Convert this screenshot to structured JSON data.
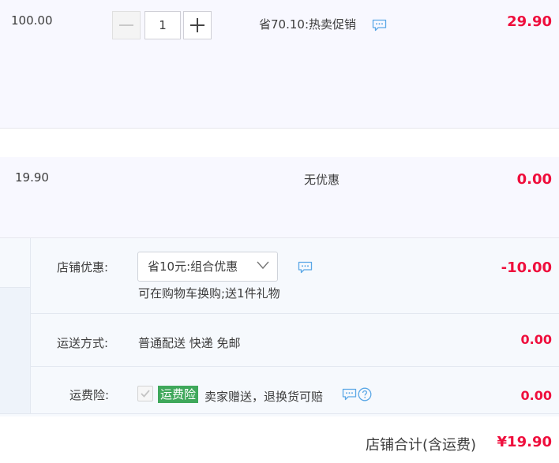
{
  "items": [
    {
      "unit_price": "100.00",
      "quantity": "1",
      "promo": "省70.10:热卖促销",
      "subtotal": "29.90"
    },
    {
      "unit_price": "19.90",
      "promo": "无优惠",
      "subtotal": "0.00"
    }
  ],
  "shop": {
    "discount_label": "店铺优惠:",
    "discount_selected": "省10元:组合优惠",
    "discount_note": "可在购物车换购;送1件礼物",
    "discount_amount": "-10.00",
    "shipping_label": "运送方式:",
    "shipping_value": "普通配送 快递 免邮",
    "shipping_amount": "0.00",
    "insurance_label": "运费险:",
    "insurance_badge": "运费险",
    "insurance_desc": "卖家赠送，退换货可赔",
    "insurance_amount": "0.00",
    "total_label": "店铺合计(含运费)",
    "total_value": "¥19.90"
  },
  "colors": {
    "accent_red": "#ef0f3d",
    "badge_green": "#3fa85b",
    "icon_blue": "#5aa7e6"
  },
  "icons": [
    "minus-icon",
    "plus-icon",
    "message-icon",
    "chevron-down-icon",
    "check-icon",
    "help-icon"
  ]
}
